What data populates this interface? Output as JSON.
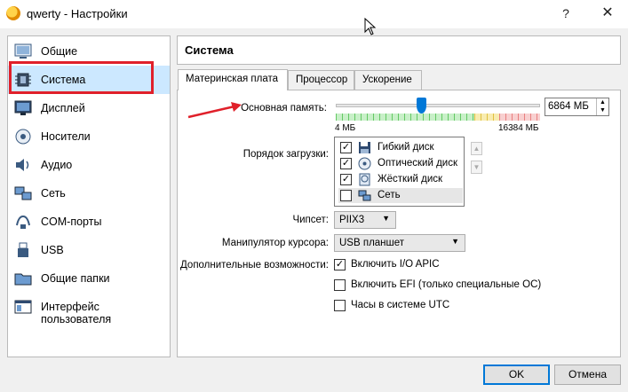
{
  "window": {
    "title": "qwerty - Настройки",
    "help_glyph": "?",
    "close_glyph": "✕"
  },
  "sidebar": {
    "items": [
      {
        "label": "Общие",
        "icon": "general-icon"
      },
      {
        "label": "Система",
        "icon": "system-icon",
        "selected": true
      },
      {
        "label": "Дисплей",
        "icon": "display-icon"
      },
      {
        "label": "Носители",
        "icon": "storage-icon"
      },
      {
        "label": "Аудио",
        "icon": "audio-icon"
      },
      {
        "label": "Сеть",
        "icon": "network-icon"
      },
      {
        "label": "COM-порты",
        "icon": "serial-port-icon"
      },
      {
        "label": "USB",
        "icon": "usb-icon"
      },
      {
        "label": "Общие папки",
        "icon": "shared-folders-icon"
      },
      {
        "label": "Интерфейс пользователя",
        "icon": "user-interface-icon"
      }
    ]
  },
  "main": {
    "title": "Система",
    "tabs": [
      {
        "label": "Материнская плата",
        "active": true
      },
      {
        "label": "Процессор"
      },
      {
        "label": "Ускорение"
      }
    ],
    "memory": {
      "label": "Основная память:",
      "min_label": "4 МБ",
      "max_label": "16384 МБ",
      "value": "6864 МБ",
      "slider_fraction": 0.419
    },
    "boot": {
      "label": "Порядок загрузки:",
      "items": [
        {
          "label": "Гибкий диск",
          "checked": true,
          "check": "✓",
          "icon": "floppy-icon"
        },
        {
          "label": "Оптический диск",
          "checked": true,
          "check": "✓",
          "icon": "optical-disc-icon"
        },
        {
          "label": "Жёсткий диск",
          "checked": true,
          "check": "✓",
          "icon": "hard-disk-icon"
        },
        {
          "label": "Сеть",
          "checked": false,
          "check": "",
          "icon": "network-boot-icon"
        }
      ],
      "up_glyph": "▲",
      "down_glyph": "▼"
    },
    "chipset": {
      "label": "Чипсет:",
      "value": "PIIX3"
    },
    "pointing": {
      "label": "Манипулятор курсора:",
      "value": "USB планшет"
    },
    "features": {
      "label": "Дополнительные возможности:",
      "items": [
        {
          "label": "Включить I/O APIC",
          "checked": true,
          "check": "✓"
        },
        {
          "label": "Включить EFI (только специальные ОС)",
          "checked": false,
          "check": ""
        },
        {
          "label": "Часы в системе UTC",
          "checked": false,
          "check": ""
        }
      ]
    }
  },
  "buttons": {
    "ok": "OK",
    "cancel": "Отмена"
  },
  "colors": {
    "accent": "#0078d7",
    "highlight": "#e0202a",
    "selection": "#cce8ff"
  }
}
